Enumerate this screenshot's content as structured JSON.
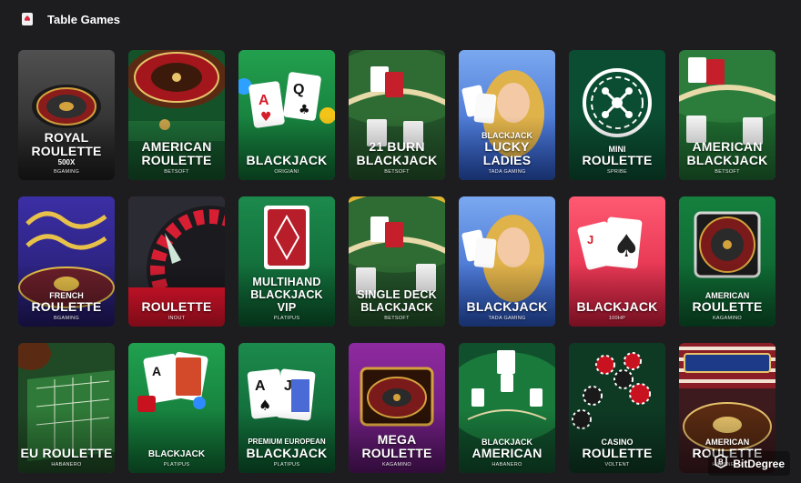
{
  "header": {
    "title": "Table Games",
    "icon": "cards-icon"
  },
  "watermark": {
    "text": "BitDegree"
  },
  "tiles": [
    {
      "pre": "",
      "name": "ROYAL ROULETTE",
      "sub": "500X",
      "provider": "BGAMING",
      "bg": "#3a3a3a"
    },
    {
      "pre": "",
      "name": "AMERICAN ROULETTE",
      "sub": "",
      "provider": "BETSOFT",
      "bg": "#1f6b34"
    },
    {
      "pre": "",
      "name": "BLACKJACK",
      "sub": "",
      "provider": "ORIGIANI",
      "bg": "#17803d"
    },
    {
      "pre": "",
      "name": "21 BURN BLACKJACK",
      "sub": "",
      "provider": "BETSOFT",
      "bg": "#2b5e2a"
    },
    {
      "pre": "BLACKJACK",
      "name": "LUCKY LADIES",
      "sub": "",
      "provider": "TADA GAMING",
      "bg": "#3b6ad0"
    },
    {
      "pre": "MINI",
      "name": "ROULETTE",
      "sub": "",
      "provider": "SPRIBE",
      "bg": "#0d5a3a"
    },
    {
      "pre": "",
      "name": "AMERICAN BLACKJACK",
      "sub": "",
      "provider": "BETSOFT",
      "bg": "#2a7a3a"
    },
    {
      "pre": "FRENCH",
      "name": "ROULETTE",
      "sub": "",
      "provider": "BGAMING",
      "bg": "#3a2a86"
    },
    {
      "pre": "",
      "name": "ROULETTE",
      "sub": "",
      "provider": "INOUT",
      "bg": "#c3152a"
    },
    {
      "pre": "",
      "name": "MULTIHAND BLACKJACK VIP",
      "sub": "",
      "provider": "PLATIPUS",
      "bg": "#12703f"
    },
    {
      "pre": "",
      "name": "SINGLE DECK BLACKJACK",
      "sub": "",
      "provider": "BETSOFT",
      "bg": "#2b5e2a"
    },
    {
      "pre": "",
      "name": "BLACKJACK",
      "sub": "",
      "provider": "TADA GAMING",
      "bg": "#3b6ad0"
    },
    {
      "pre": "",
      "name": "BLACKJACK",
      "sub": "",
      "provider": "100HP",
      "bg": "#e2324f"
    },
    {
      "pre": "AMERICAN",
      "name": "ROULETTE",
      "sub": "",
      "provider": "KAGAMINO",
      "bg": "#11703a"
    },
    {
      "pre": "",
      "name": "EU ROULETTE",
      "sub": "",
      "provider": "HABANERO",
      "bg": "#2a5e2f"
    },
    {
      "pre": "BLACKJACK",
      "name": "",
      "sub": "",
      "provider": "PLATIPUS",
      "bg": "#1b8a3f"
    },
    {
      "pre": "PREMIUM EUROPEAN",
      "name": "BLACKJACK",
      "sub": "",
      "provider": "PLATIPUS",
      "bg": "#117b42"
    },
    {
      "pre": "",
      "name": "MEGA ROULETTE",
      "sub": "",
      "provider": "KAGAMINO",
      "bg": "#7a1f8a"
    },
    {
      "pre": "BLACKJACK",
      "name": "AMERICAN",
      "sub": "",
      "provider": "HABANERO",
      "bg": "#14663a"
    },
    {
      "pre": "CASINO",
      "name": "ROULETTE",
      "sub": "",
      "provider": "VOLTENT",
      "bg": "#1a5a33"
    },
    {
      "pre": "AMERICAN",
      "name": "ROULETTE",
      "sub": "",
      "provider": "HABANERO",
      "bg": "#4a2228"
    }
  ]
}
